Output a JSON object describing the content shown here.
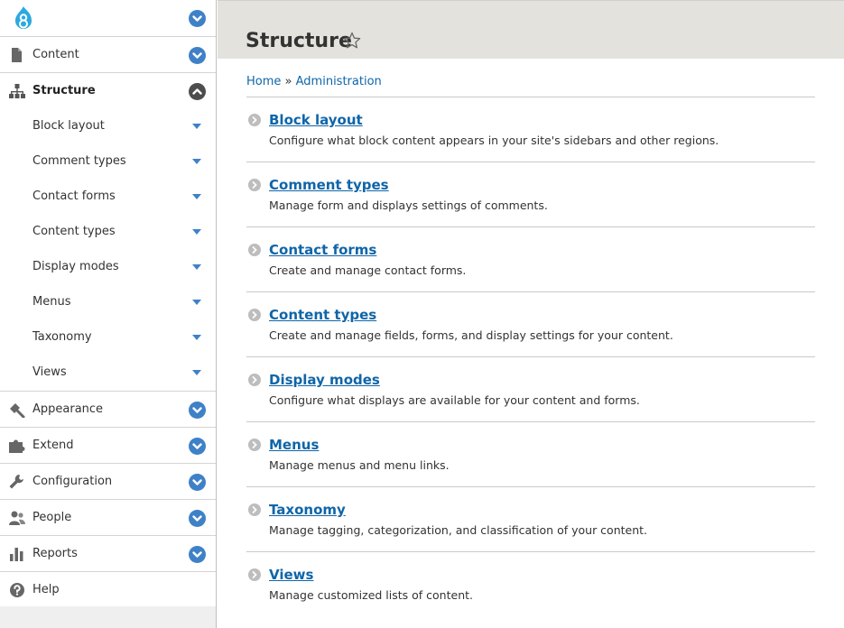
{
  "sidebar": {
    "top_items": [
      {
        "label": "Content",
        "icon": "file-icon"
      },
      {
        "label": "Structure",
        "icon": "sitemap-icon"
      }
    ],
    "structure_children": [
      "Block layout",
      "Comment types",
      "Contact forms",
      "Content types",
      "Display modes",
      "Menus",
      "Taxonomy",
      "Views"
    ],
    "bottom_items": [
      {
        "label": "Appearance",
        "icon": "paintbrush-icon"
      },
      {
        "label": "Extend",
        "icon": "puzzle-icon"
      },
      {
        "label": "Configuration",
        "icon": "wrench-icon"
      },
      {
        "label": "People",
        "icon": "people-icon"
      },
      {
        "label": "Reports",
        "icon": "bar-chart-icon"
      },
      {
        "label": "Help",
        "icon": "help-icon"
      }
    ]
  },
  "header": {
    "title": "Structure"
  },
  "breadcrumb": {
    "home": "Home",
    "separator": "»",
    "administration": "Administration"
  },
  "entries": [
    {
      "title": "Block layout",
      "description": "Configure what block content appears in your site's sidebars and other regions."
    },
    {
      "title": "Comment types",
      "description": "Manage form and displays settings of comments."
    },
    {
      "title": "Contact forms",
      "description": "Create and manage contact forms."
    },
    {
      "title": "Content types",
      "description": "Create and manage fields, forms, and display settings for your content."
    },
    {
      "title": "Display modes",
      "description": "Configure what displays are available for your content and forms."
    },
    {
      "title": "Menus",
      "description": "Manage menus and menu links."
    },
    {
      "title": "Taxonomy",
      "description": "Manage tagging, categorization, and classification of your content."
    },
    {
      "title": "Views",
      "description": "Manage customized lists of content."
    }
  ],
  "colors": {
    "link": "#0f65a8",
    "accent": "#3f81c7",
    "header_bg": "#e3e2dc"
  }
}
